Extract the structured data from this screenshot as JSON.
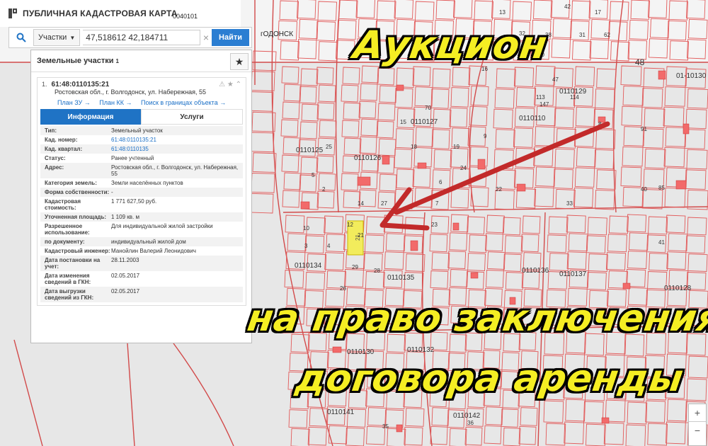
{
  "header": {
    "title": "ПУБЛИЧНАЯ КАДАСТРОВАЯ КАРТА"
  },
  "search": {
    "type_label": "Участки",
    "value": "47,518612 42,184711",
    "find_label": "Найти"
  },
  "map_top_text": {
    "city": "гОДОНСК",
    "quarter_top": "0040101"
  },
  "panel": {
    "heading": "Земельные участки",
    "heading_count": "1",
    "card": {
      "index": "1.",
      "cad_number": "61:48:0110135:21",
      "address": "Ростовская обл., г. Волгодонск, ул. Набережная, 55",
      "links": [
        "План ЗУ →",
        "План КК →",
        "Поиск в границах объекта →"
      ],
      "tabs": [
        "Информация",
        "Услуги"
      ],
      "rows": [
        {
          "k": "Тип:",
          "v": "Земельный участок"
        },
        {
          "k": "Кад. номер:",
          "v": "61:48:0110135:21"
        },
        {
          "k": "Кад. квартал:",
          "v": "61:48:0110135"
        },
        {
          "k": "Статус:",
          "v": "Ранее учтенный"
        },
        {
          "k": "Адрес:",
          "v": "Ростовская обл., г. Волгодонск, ул. Набережная, 55"
        },
        {
          "k": "Категория земель:",
          "v": "Земли населённых пунктов"
        },
        {
          "k": "Форма собственности:",
          "v": "-"
        },
        {
          "k": "Кадастровая стоимость:",
          "v": "1 771 627,50 руб."
        },
        {
          "k": "Уточненная площадь:",
          "v": "1 109 кв. м"
        },
        {
          "k": "Разрешенное использование:",
          "v": "Для индивидуальной жилой застройки"
        },
        {
          "k": "по документу:",
          "v": "индивидуальный жилой дом"
        },
        {
          "k": "Кадастровый инженер:",
          "v": "Манойлин Валерий Леонидович"
        },
        {
          "k": "Дата постановки на учет:",
          "v": "28.11.2003"
        },
        {
          "k": "Дата изменения сведений в ГКН:",
          "v": "02.05.2017"
        },
        {
          "k": "Дата выгрузки сведений из ГКН:",
          "v": "02.05.2017"
        }
      ]
    }
  },
  "overlay": {
    "line1": "Аукцион",
    "line2": "на право заключения",
    "line3": "договора аренды"
  },
  "map_labels": {
    "quarters": [
      "0110129",
      "0110127",
      "0110125",
      "0110126",
      "0110134",
      "0110135",
      "0110137",
      "0110136",
      "0110132",
      "0110130",
      "0110141",
      "0110142",
      "01-10130",
      "0110110",
      "0110128"
    ],
    "parcels": [
      "48",
      "62",
      "42",
      "31",
      "38",
      "30",
      "13",
      "17",
      "12",
      "10",
      "9",
      "8",
      "15",
      "23",
      "28",
      "21",
      "29",
      "35",
      "36",
      "91",
      "85",
      "26",
      "27",
      "70",
      "3",
      "4",
      "2",
      "5",
      "6",
      "7",
      "14",
      "16",
      "18",
      "19",
      "22",
      "24",
      "25",
      "32",
      "33",
      "40",
      "41",
      "47",
      "113",
      "114",
      "147"
    ]
  },
  "colors": {
    "parcel_line": "#e34a4a",
    "highlight": "#f2ec5c",
    "arrow": "#c42a2a",
    "overlay_text": "#f5ee23",
    "accent": "#1f73c5"
  },
  "icons": [
    "logo-icon",
    "search-icon",
    "clear-icon",
    "star-icon",
    "zoom-in-icon",
    "zoom-out-icon"
  ],
  "zoom": {
    "plus": "+",
    "minus": "−"
  }
}
